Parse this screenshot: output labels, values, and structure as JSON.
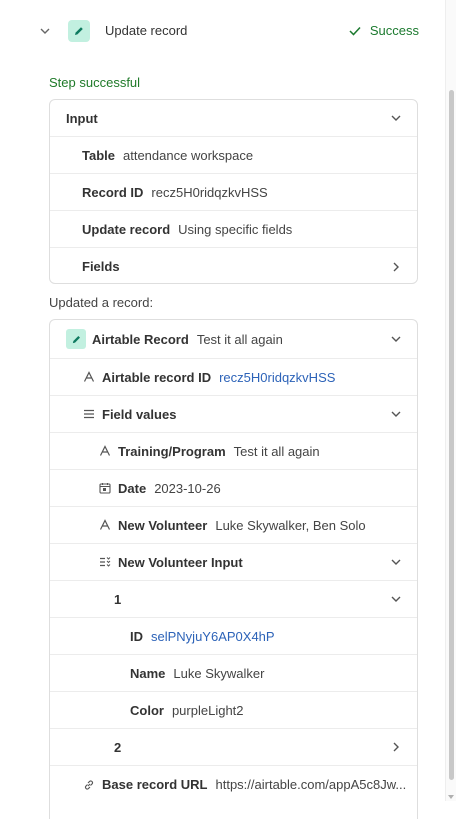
{
  "step": {
    "title": "Update record",
    "status": "Success"
  },
  "result_text": "Step successful",
  "input": {
    "title": "Input",
    "table_label": "Table",
    "table_value": "attendance workspace",
    "record_id_label": "Record ID",
    "record_id_value": "recz5H0ridqzkvHSS",
    "update_record_label": "Update record",
    "update_record_value": "Using specific fields",
    "fields_label": "Fields"
  },
  "output": {
    "caption": "Updated a record:",
    "airtable_record_label": "Airtable Record",
    "airtable_record_value": "Test it all again",
    "airtable_record_id_label": "Airtable record ID",
    "airtable_record_id_value": "recz5H0ridqzkvHSS",
    "field_values_label": "Field values",
    "fields": {
      "training_program_label": "Training/Program",
      "training_program_value": "Test it all again",
      "date_label": "Date",
      "date_value": "2023-10-26",
      "new_volunteer_label": "New Volunteer",
      "new_volunteer_value": "Luke Skywalker, Ben Solo",
      "new_volunteer_input_label": "New Volunteer Input",
      "items": [
        {
          "index": "1",
          "id_label": "ID",
          "id_value": "selPNyjuY6AP0X4hP",
          "name_label": "Name",
          "name_value": "Luke Skywalker",
          "color_label": "Color",
          "color_value": "purpleLight2"
        },
        {
          "index": "2"
        }
      ]
    },
    "base_record_url_label": "Base record URL",
    "base_record_url_value": "https://airtable.com/appA5c8Jw..."
  },
  "colors": {
    "success": "#1c7a2f",
    "link": "#2d63b8",
    "icon_bg": "#c2f0e0",
    "icon_fg": "#0d7a5f"
  }
}
